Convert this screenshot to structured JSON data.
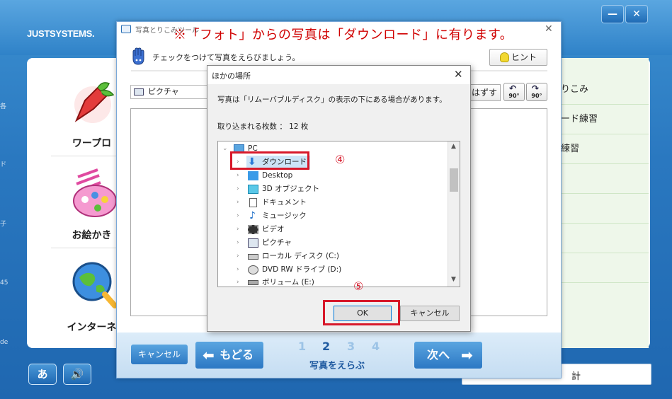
{
  "background_app": {
    "logo": "JUSTSYSTEMS.",
    "window_controls": {
      "minimize": "—",
      "close": "✕"
    },
    "left_menu": [
      {
        "label": "ワープロ"
      },
      {
        "label": "お絵かき"
      },
      {
        "label": "インターネ"
      }
    ],
    "right_menu": [
      {
        "label": "りこみ"
      },
      {
        "label": "ード練習"
      },
      {
        "label": "練習"
      }
    ],
    "left_edge_chars": [
      "各",
      "ド",
      "子",
      "45",
      "de"
    ],
    "bottom_field_text": "計"
  },
  "photo_dialog": {
    "title": "写真とりこみツール",
    "annotation_note": "※「フォト」からの写真は「ダウンロード」に有ります。",
    "instruction": "チェックをつけて写真をえらびましょう。",
    "hint_label": "ヒント",
    "folder_value": "ピクチャ",
    "deselect_label": "はずす",
    "rotate_left_label": "90°",
    "rotate_right_label": "90°",
    "footer": {
      "cancel_label": "キャンセル",
      "back_label": "もどる",
      "next_label": "次へ",
      "steps": [
        "1",
        "2",
        "3",
        "4"
      ],
      "active_step": 2,
      "step_label": "写真をえらぶ"
    }
  },
  "other_location_dialog": {
    "title": "ほかの場所",
    "message": "写真は「リムーバブルディスク」の表示の下にある場合があります。",
    "count_label": "取り込まれる枚数 ： 12 枚",
    "tree": {
      "root": "PC",
      "items": [
        {
          "label": "ダウンロード",
          "icon": "download-arrow-icon",
          "selected": true
        },
        {
          "label": "Desktop",
          "icon": "desktop-icon"
        },
        {
          "label": "3D オブジェクト",
          "icon": "3d-object-icon"
        },
        {
          "label": "ドキュメント",
          "icon": "document-icon"
        },
        {
          "label": "ミュージック",
          "icon": "music-note-icon"
        },
        {
          "label": "ビデオ",
          "icon": "film-icon"
        },
        {
          "label": "ピクチャ",
          "icon": "picture-icon"
        },
        {
          "label": "ローカル ディスク (C:)",
          "icon": "local-disk-icon"
        },
        {
          "label": "DVD RW ドライブ (D:)",
          "icon": "dvd-drive-icon"
        },
        {
          "label": "ボリューム (E:)",
          "icon": "drive-icon"
        }
      ]
    },
    "ok_label": "OK",
    "cancel_label": "キャンセル"
  },
  "annotations": {
    "step4": "④",
    "step5": "⑤",
    "color": "#d7182a"
  }
}
